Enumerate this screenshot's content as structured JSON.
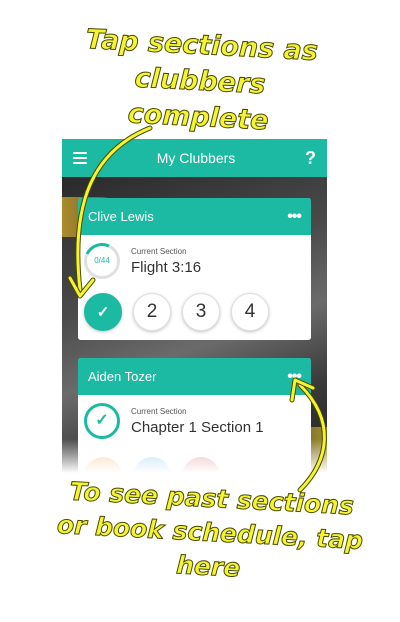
{
  "header": {
    "title": "My Clubbers",
    "menu_icon": "hamburger-menu-icon",
    "help_label": "?"
  },
  "colors": {
    "accent": "#1cbaa3",
    "annotation": "#f4f432"
  },
  "clubbers": [
    {
      "name": "Clive Lewis",
      "more_label": "•••",
      "progress_text": "0/44",
      "current_section_label": "Current Section",
      "current_section": "Flight 3:16",
      "section_buttons": [
        "✓",
        "2",
        "3",
        "4"
      ]
    },
    {
      "name": "Aiden Tozer",
      "more_label": "•••",
      "current_section_label": "Current Section",
      "current_section": "Chapter 1 Section 1",
      "check_label": "✓"
    }
  ],
  "annotations": {
    "top": "Tap sections as clubbers complete",
    "bottom": "To see past sections or book schedule, tap here"
  }
}
